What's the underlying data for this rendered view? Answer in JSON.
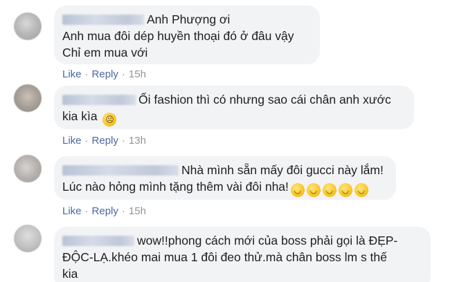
{
  "comments": [
    {
      "lines": [
        "Anh Phượng ơi",
        "Anh mua đôi dép huyền thoại đó ở đâu vậy",
        "Chỉ em mua với"
      ],
      "like": "Like",
      "reply": "Reply",
      "sep": "·",
      "time": "15h",
      "emoji_icons": []
    },
    {
      "lines": [
        "Ối fashion thì có nhưng sao cái chân anh xước",
        "kia kìa"
      ],
      "like": "Like",
      "reply": "Reply",
      "sep": "·",
      "time": "13h",
      "emoji_icons": [
        "sad-sweat-face-emoji"
      ]
    },
    {
      "lines": [
        "Nhà mình sẵn mấy đôi gucci này lắm!",
        "Lúc nào hỏng mình tặng thêm vài đôi nha!"
      ],
      "like": "Like",
      "reply": "Reply",
      "sep": "·",
      "time": "15h",
      "emoji_icons": [
        "laughing-sweat-emoji",
        "laughing-sweat-emoji",
        "laughing-sweat-emoji",
        "laughing-sweat-emoji",
        "laughing-sweat-emoji"
      ]
    },
    {
      "lines": [
        "wow!!phong cách mới của boss phải gọi là ĐẸP-",
        "ĐỘC-LẠ.khéo mai mua 1 đôi đeo thử.mà chân boss lm s thế",
        "kia"
      ]
    }
  ]
}
